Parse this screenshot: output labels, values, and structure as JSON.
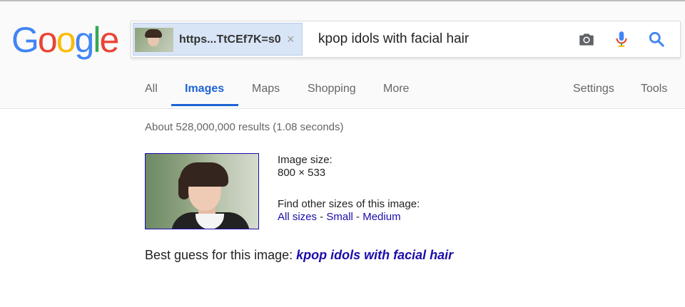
{
  "logo": {
    "text": "Google",
    "colors": [
      "#4285f4",
      "#ea4335",
      "#fbbc05",
      "#4285f4",
      "#34a853",
      "#ea4335"
    ]
  },
  "search": {
    "chip_text": "https...TtCEf7K=s0",
    "chip_close": "×",
    "query": "kpop idols with facial hair",
    "icons": [
      "camera-icon",
      "mic-icon",
      "search-icon"
    ]
  },
  "tabs": {
    "items": [
      "All",
      "Images",
      "Maps",
      "Shopping",
      "More"
    ],
    "active": "Images",
    "right": [
      "Settings",
      "Tools"
    ]
  },
  "results": {
    "stats": "About 528,000,000 results (1.08 seconds)",
    "image_size_label": "Image size:",
    "image_size_value": "800 × 533",
    "find_other_label": "Find other sizes of this image:",
    "size_links": [
      "All sizes",
      "Small",
      "Medium"
    ],
    "separator": " - ",
    "best_guess_label": "Best guess for this image: ",
    "best_guess_value": "kpop idols with facial hair"
  },
  "colors": {
    "link": "#1a0dab",
    "active_tab": "#1e63d6"
  }
}
